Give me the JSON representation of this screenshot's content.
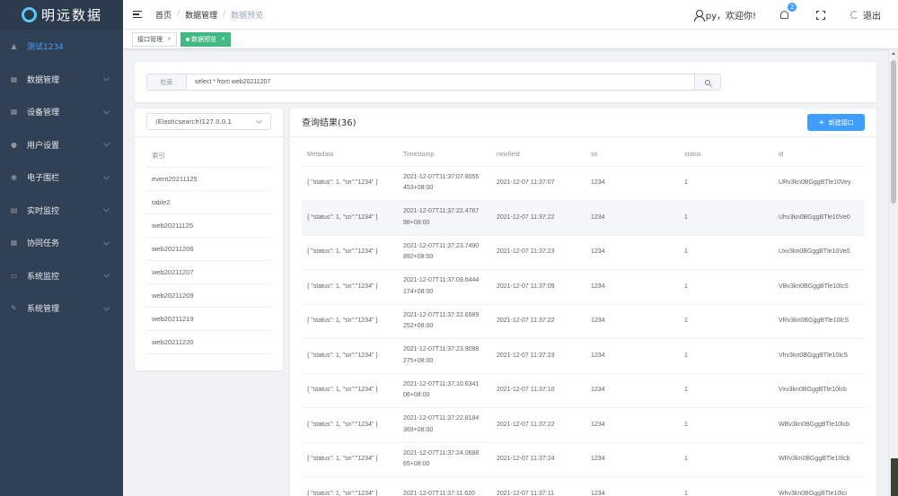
{
  "app": {
    "logo_text": "明远数据"
  },
  "sidebar": {
    "project_label": "测试1234",
    "items": [
      {
        "label": "数据管理",
        "icon": "grid-icon"
      },
      {
        "label": "设备管理",
        "icon": "grid-icon"
      },
      {
        "label": "用户设置",
        "icon": "user-icon"
      },
      {
        "label": "电子围栏",
        "icon": "eye-icon"
      },
      {
        "label": "实时监控",
        "icon": "message-icon"
      },
      {
        "label": "协同任务",
        "icon": "grid-icon"
      },
      {
        "label": "系统监控",
        "icon": "monitor-icon"
      },
      {
        "label": "系统管理",
        "icon": "edit-icon"
      }
    ]
  },
  "header": {
    "breadcrumb": [
      "首页",
      "数据管理",
      "数据预览"
    ],
    "user_greeting": "py，欢迎你!",
    "notification_count": "2",
    "logout_label": "退出"
  },
  "tags": [
    {
      "label": "接口管理",
      "active": false
    },
    {
      "label": "数据预览",
      "active": true
    }
  ],
  "search": {
    "prefix": "检索",
    "value": "select * from web20211207"
  },
  "datasource": {
    "selected": "(Elasticsearch)127.0.0.1"
  },
  "index_list": {
    "header": "索引",
    "items": [
      "event20211125",
      "table2",
      "web20211125",
      "web20211206",
      "web20211207",
      "web20211209",
      "web20211219",
      "web20211220"
    ]
  },
  "result": {
    "title": "查询结果(36)",
    "new_button": "新建接口",
    "columns": [
      "Metadata",
      "Timestamp",
      "newfield",
      "sn",
      "status",
      "id"
    ],
    "rows": [
      [
        "{ \"status\": 1, \"sn\":\"1234\" }",
        "2021-12-07T11:37:07.8055453+08:00",
        "2021-12-07 11:37:07",
        "1234",
        "1",
        "URv3kn0BGggBTle10Vey"
      ],
      [
        "{ \"status\": 1, \"sn\":\"1234\" }",
        "2021-12-07T11:37:22.476798+08:00",
        "2021-12-07 11:37:22",
        "1234",
        "1",
        "Uhv3kn0BGggBTle10Ve0"
      ],
      [
        "{ \"status\": 1, \"sn\":\"1234\" }",
        "2021-12-07T11:37:23.7490892+08:00",
        "2021-12-07 11:37:23",
        "1234",
        "1",
        "Uxv3kn0BGggBTle10Ve0"
      ],
      [
        "{ \"status\": 1, \"sn\":\"1234\" }",
        "2021-12-07T11:37:09.6444174+08:00",
        "2021-12-07 11:37:09",
        "1234",
        "1",
        "VBv3kn0BGggBTle10lcS"
      ],
      [
        "{ \"status\": 1, \"sn\":\"1234\" }",
        "2021-12-07T11:37:22.6589252+08:00",
        "2021-12-07 11:37:22",
        "1234",
        "1",
        "VRv3kn0BGggBTle10lcS"
      ],
      [
        "{ \"status\": 1, \"sn\":\"1234\" }",
        "2021-12-07T11:37:23.9098275+08:00",
        "2021-12-07 11:37:23",
        "1234",
        "1",
        "Vhv3kn0BGggBTle10lcS"
      ],
      [
        "{ \"status\": 1, \"sn\":\"1234\" }",
        "2021-12-07T11:37:10.634106+08:00",
        "2021-12-07 11:37:10",
        "1234",
        "1",
        "Vxv3kn0BGggBTle10lcb"
      ],
      [
        "{ \"status\": 1, \"sn\":\"1234\" }",
        "2021-12-07T11:37:22.8184369+08:00",
        "2021-12-07 11:37:22",
        "1234",
        "1",
        "WBv3kn0BGggBTle10lcb"
      ],
      [
        "{ \"status\": 1, \"sn\":\"1234\" }",
        "2021-12-07T11:37:24.068865+08:00",
        "2021-12-07 11:37:24",
        "1234",
        "1",
        "WRv3kn0BGggBTle10lcb"
      ],
      [
        "{ \"status\": 1, \"sn\":\"1234\" }",
        "2021-12-07T11:37:11.620",
        "2021-12-07 11:37:11",
        "1234",
        "1",
        "Whv3kn0BGggBTle10lci"
      ]
    ],
    "highlighted_row": 1
  },
  "colors": {
    "sidebar_bg": "#304156",
    "accent": "#409eff",
    "tag_active": "#42b983"
  }
}
